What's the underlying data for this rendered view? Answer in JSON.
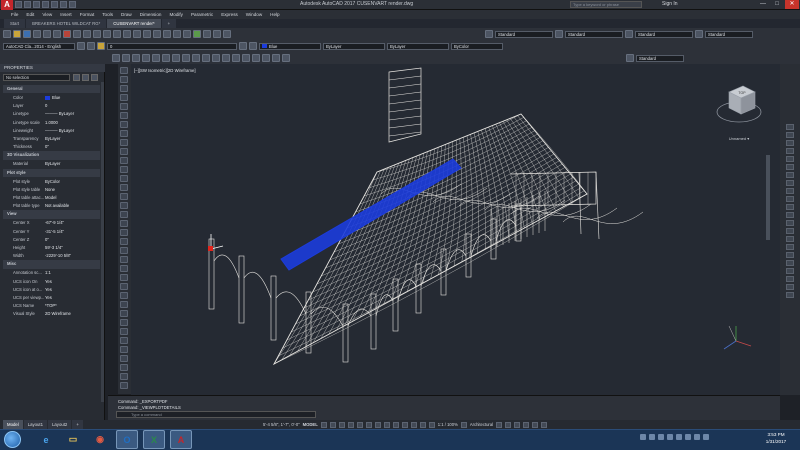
{
  "titlebar": {
    "app_initial": "A",
    "title": "Autodesk AutoCAD 2017   CUSENVART render.dwg",
    "search_placeholder": "Type a keyword or phrase",
    "signin": "Sign In",
    "minimize": "—",
    "maximize": "□",
    "close": "✕"
  },
  "menu": [
    "File",
    "Edit",
    "View",
    "Insert",
    "Format",
    "Tools",
    "Draw",
    "Dimension",
    "Modify",
    "Parametric",
    "Express",
    "Window",
    "Help"
  ],
  "doc_tabs": [
    "Start",
    "BREAKERS HOTEL WILDCAT RG*",
    "CUSENVART render*",
    "+"
  ],
  "toolbar": {
    "workspace": "AutoCAD Cla...2014 - English",
    "layer": "0",
    "color": "Blue",
    "linetype": "ByLayer",
    "lineweight": "ByLayer",
    "plotstyle": "ByColor",
    "text_style": "Standard",
    "dim_style": "Standard",
    "table_style": "Standard",
    "multileader_style": "Standard",
    "visual_style": "Standard"
  },
  "properties": {
    "title": "PROPERTIES",
    "selection": "No selection",
    "rows": [
      {
        "cat": true,
        "k": "General"
      },
      {
        "k": "Color",
        "v": "Blue",
        "swatch": true
      },
      {
        "k": "Layer",
        "v": "0"
      },
      {
        "k": "Linetype",
        "v": "——— ByLayer"
      },
      {
        "k": "Linetype scale",
        "v": "1.0000"
      },
      {
        "k": "Lineweight",
        "v": "——— ByLayer"
      },
      {
        "k": "Transparency",
        "v": "ByLayer"
      },
      {
        "k": "Thickness",
        "v": "0\""
      },
      {
        "cat": true,
        "k": "3D Visualization"
      },
      {
        "k": "Material",
        "v": "ByLayer"
      },
      {
        "cat": true,
        "k": "Plot style"
      },
      {
        "k": "Plot style",
        "v": "ByColor"
      },
      {
        "k": "Plot style table",
        "v": "None"
      },
      {
        "k": "Plot table attac...",
        "v": "Model"
      },
      {
        "k": "Plot table type",
        "v": "Not available"
      },
      {
        "cat": true,
        "k": "View"
      },
      {
        "k": "Center X",
        "v": "-67'-9 1/4\""
      },
      {
        "k": "Center Y",
        "v": "-31'-5 1/4\""
      },
      {
        "k": "Center Z",
        "v": "0\""
      },
      {
        "k": "Height",
        "v": "59'-3 1/4\""
      },
      {
        "k": "Width",
        "v": "-2229'-10 5/8\""
      },
      {
        "cat": true,
        "k": "Misc"
      },
      {
        "k": "Annotation sc...",
        "v": "1:1"
      },
      {
        "k": "UCS icon On",
        "v": "Yes"
      },
      {
        "k": "UCS icon at o...",
        "v": "Yes"
      },
      {
        "k": "UCS per viewp...",
        "v": "Yes"
      },
      {
        "k": "UCS Name",
        "v": "*TOP*"
      },
      {
        "k": "Visual Style",
        "v": "2D Wireframe"
      }
    ]
  },
  "viewport": {
    "label": "[–][SW Isometric][2D Wireframe]",
    "viewcube_label": "Unnamed ▾",
    "viewcube_face": "TOP",
    "colors": {
      "wire": "#e8e6e2",
      "highlight": "#1c3cdc",
      "bg": "#252a33"
    }
  },
  "command": {
    "line1": "Command: _EXPORTPDF",
    "line2": "Command: _VIEWPLOTDETAILS",
    "placeholder": "Type a command"
  },
  "layout_tabs": [
    "Model",
    "Layout1",
    "Layout2",
    "+"
  ],
  "status": {
    "coords": "5'-4 5/8\", 1'-7\", 0'-0\"",
    "model": "MODEL",
    "scale": "1:1 / 100%",
    "units": "Architectural"
  },
  "taskbar": {
    "apps": [
      {
        "name": "ie",
        "glyph": "e",
        "color": "#4aa3ec"
      },
      {
        "name": "explorer",
        "glyph": "▭",
        "color": "#e6c35a"
      },
      {
        "name": "chrome",
        "glyph": "◉",
        "color": "#e45b43"
      },
      {
        "name": "outlook",
        "glyph": "O",
        "color": "#1f6fc4"
      },
      {
        "name": "excel",
        "glyph": "X",
        "color": "#2b8a4b"
      },
      {
        "name": "autocad",
        "glyph": "A",
        "color": "#c3262b"
      }
    ],
    "time": "3:53 PM",
    "date": "1/31/2017"
  }
}
